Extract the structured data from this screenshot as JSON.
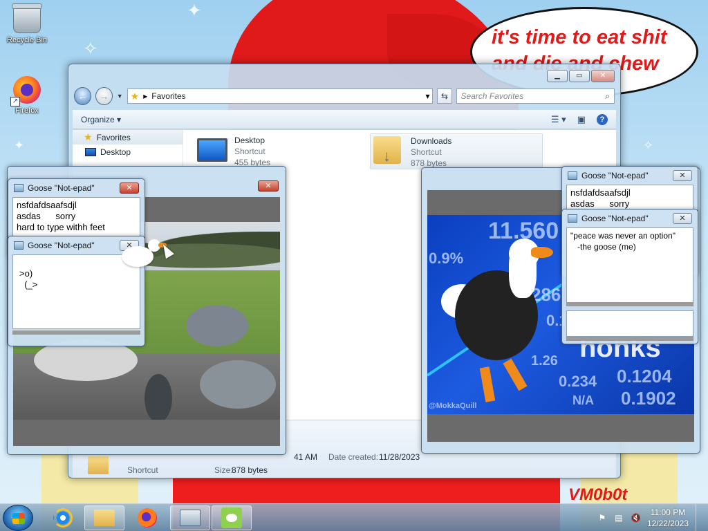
{
  "wallpaper": {
    "bubble_text": "it's time to eat shit\nand die and chew",
    "bubble_tail": "s",
    "signature": "VM0b0t"
  },
  "desktop": {
    "icons": [
      {
        "label": "Recycle Bin",
        "icon": "recycle-bin-icon"
      },
      {
        "label": "Firefox",
        "icon": "firefox-icon"
      }
    ]
  },
  "explorer": {
    "address": "Favorites",
    "search_placeholder": "Search Favorites",
    "toolbar": {
      "organize": "Organize"
    },
    "nav_pane": [
      {
        "label": "Favorites"
      },
      {
        "label": "Desktop"
      }
    ],
    "files": [
      {
        "name": "Desktop",
        "type": "Shortcut",
        "size": "455 bytes"
      },
      {
        "name": "Downloads",
        "type": "Shortcut",
        "size": "878 bytes"
      }
    ],
    "details": {
      "modified_fragment": "41 AM",
      "date_created_label": "Date created:",
      "date_created": "11/28/2023",
      "type": "Shortcut",
      "size_label": "Size:",
      "size": "878 bytes"
    }
  },
  "notepads": [
    {
      "title": "Goose \"Not-epad\"",
      "text": "nsfdafdsaafsdjl\nasdas      sorry\nhard to type withh feet"
    },
    {
      "title": "Goose \"Not-epad\"",
      "text": "\n>o)\n  (_>"
    },
    {
      "title": "Goose \"Not-epad\"",
      "text": "nsfdafdsaafsdjl\nasdas      sorry"
    },
    {
      "title": "Goose \"Not-epad\"",
      "text": "\"peace was never an option\"\n   -the goose (me)"
    }
  ],
  "stonks": {
    "numbers": [
      "11.560",
      "0.9%",
      "286",
      "0.15",
      "1.26",
      "0.1204",
      "0.234",
      "N/A",
      "0.1902"
    ],
    "word": "honks",
    "watermark": "@MokkaQuill"
  },
  "taskbar": {
    "time": "11:00 PM",
    "date": "12/22/2023"
  }
}
